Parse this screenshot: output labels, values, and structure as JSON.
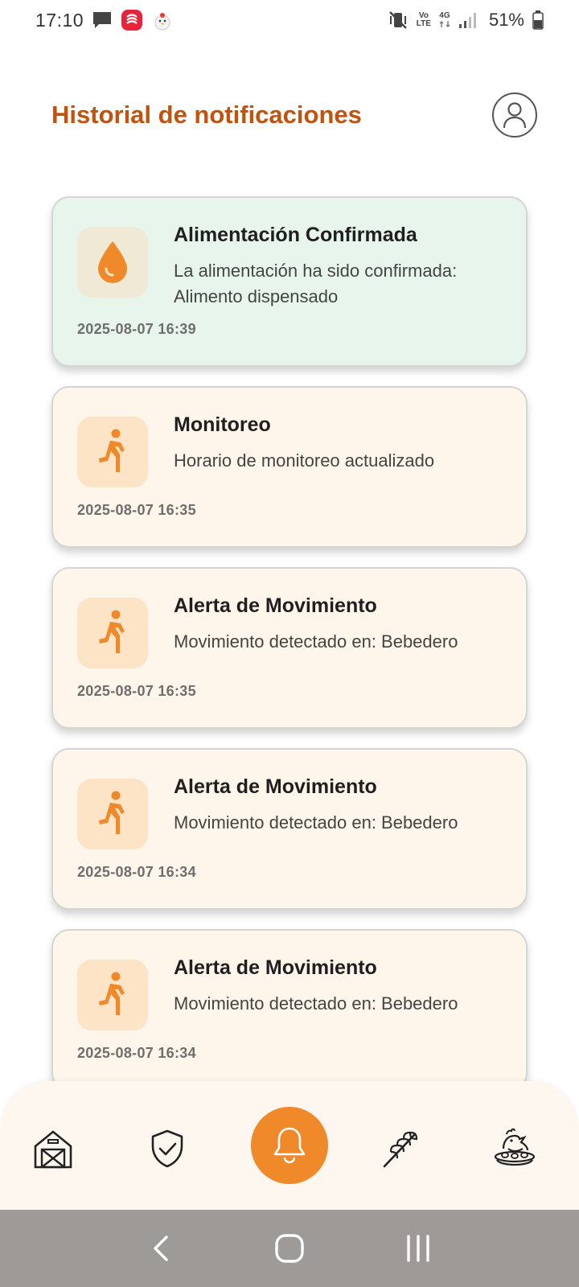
{
  "status_bar": {
    "time": "17:10",
    "battery": "51%",
    "net_vo": "Vo",
    "net_lte": "LTE",
    "net_4g": "4G",
    "icons": [
      "chat-bubble-icon",
      "app-red-icon",
      "chicken-app-icon",
      "vibrate-mute-icon",
      "volte-icon",
      "4g-icon",
      "signal-icon",
      "battery-icon"
    ]
  },
  "header": {
    "title": "Historial de notificaciones",
    "profile_icon": "user-profile-icon"
  },
  "notifications": [
    {
      "title": "Alimentación Confirmada",
      "message": "La alimentación ha sido confirmada: Alimento dispensado",
      "timestamp": "2025-08-07 16:39",
      "icon": "water-drop-icon",
      "variant": "green"
    },
    {
      "title": "Monitoreo",
      "message": "Horario de monitoreo actualizado",
      "timestamp": "2025-08-07 16:35",
      "icon": "running-person-icon",
      "variant": "peach"
    },
    {
      "title": "Alerta de Movimiento",
      "message": "Movimiento detectado en: Bebedero",
      "timestamp": "2025-08-07 16:35",
      "icon": "running-person-icon",
      "variant": "peach"
    },
    {
      "title": "Alerta de Movimiento",
      "message": "Movimiento detectado en: Bebedero",
      "timestamp": "2025-08-07 16:34",
      "icon": "running-person-icon",
      "variant": "peach"
    },
    {
      "title": "Alerta de Movimiento",
      "message": "Movimiento detectado en: Bebedero",
      "timestamp": "2025-08-07 16:34",
      "icon": "running-person-icon",
      "variant": "peach"
    }
  ],
  "bottom_nav": {
    "items": [
      "barn-icon",
      "shield-check-icon",
      "bell-icon",
      "wheat-icon",
      "hen-nest-icon"
    ],
    "active": "bell-icon"
  },
  "system_nav": [
    "back-icon",
    "home-icon",
    "recents-icon"
  ],
  "colors": {
    "accent": "#f0892a",
    "title": "#c2530e",
    "card_green": "#e8f5ec",
    "card_peach": "#fef6ea",
    "icon_orange": "#f0892a"
  }
}
